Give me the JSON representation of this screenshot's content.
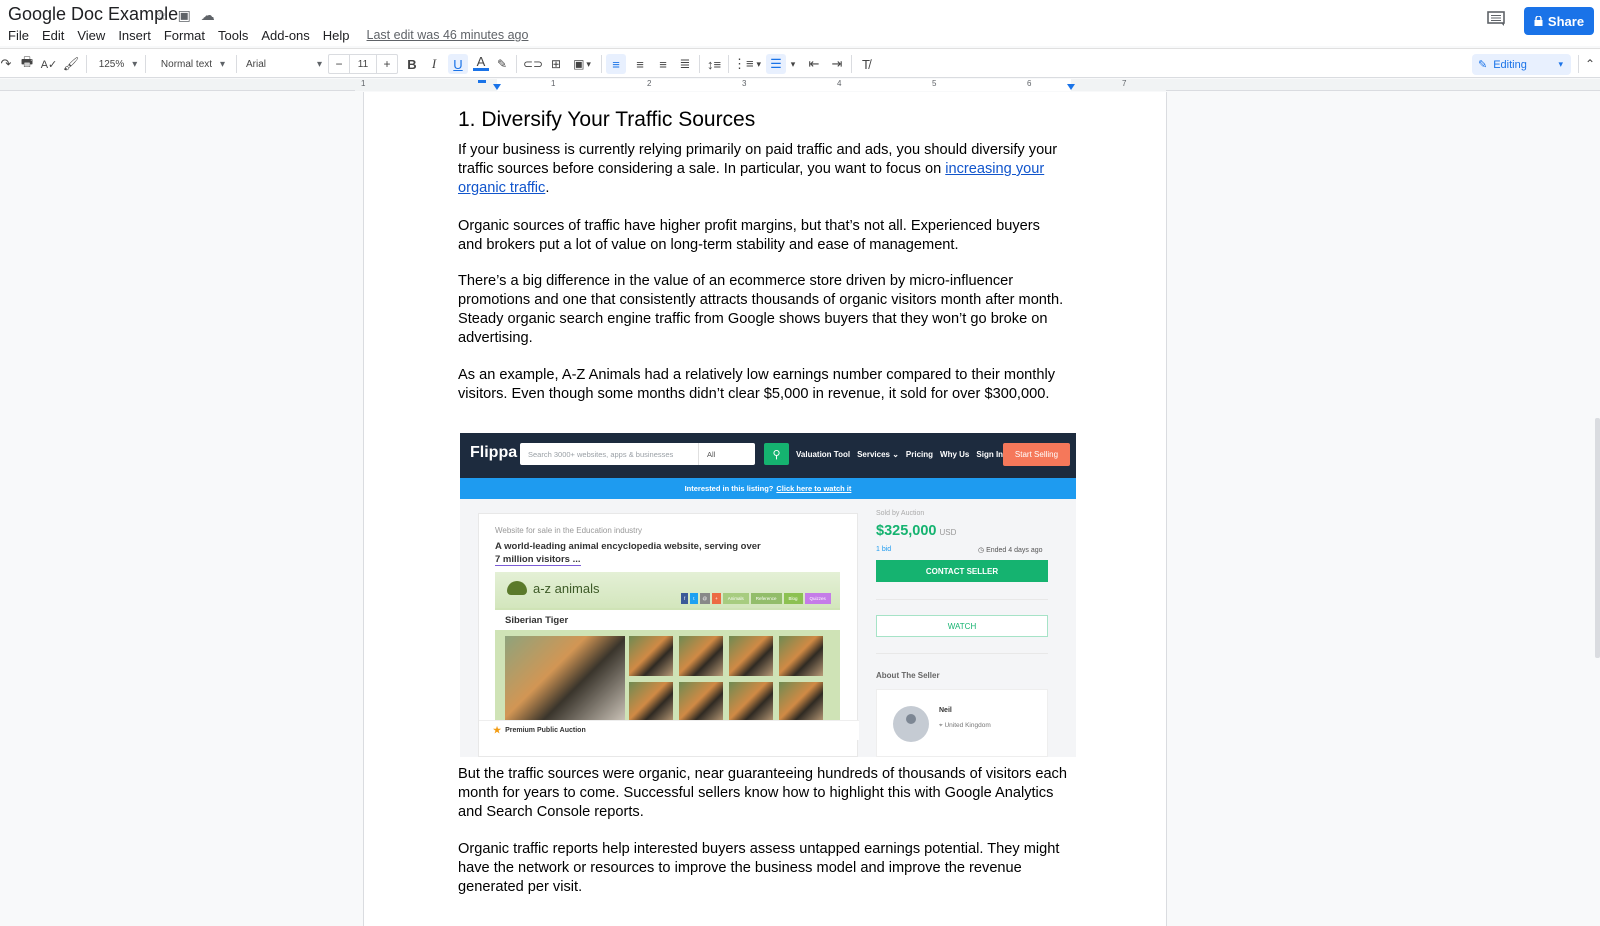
{
  "app": {
    "doc_title": "Google Doc Example",
    "last_edit": "Last edit was 46 minutes ago",
    "share_label": "Share",
    "mode_label": "Editing"
  },
  "menu": [
    "File",
    "Edit",
    "View",
    "Insert",
    "Format",
    "Tools",
    "Add-ons",
    "Help"
  ],
  "toolbar": {
    "zoom": "125%",
    "style": "Normal text",
    "font": "Arial",
    "font_size": "11",
    "minus": "−",
    "plus": "+"
  },
  "ruler": {
    "numbers": [
      "1",
      "1",
      "2",
      "3",
      "4",
      "5",
      "6",
      "7"
    ]
  },
  "document": {
    "heading": "1. Diversify Your Traffic Sources",
    "p1_before": "If your business is currently relying primarily on paid traffic and ads, you should diversify your traffic sources before considering a sale. In particular, you want to focus on ",
    "p1_link": "increasing your organic traffic",
    "p1_after": ".",
    "p2": "Organic sources of traffic have higher profit margins, but that’s not all. Experienced buyers and brokers put a lot of value on long-term stability and ease of management.",
    "p3": "There’s a big difference in the value of an ecommerce store driven by micro-influencer promotions and one that consistently attracts thousands of organic visitors month after month. Steady organic search engine traffic from Google shows buyers that they won’t go broke on advertising.",
    "p4": "As an example, A-Z Animals had a relatively low earnings number compared to their monthly visitors. Even though some months didn’t clear $5,000 in revenue, it sold for over $300,000.",
    "p5": "But the traffic sources were organic, near guaranteeing hundreds of thousands of visitors each month for years to come. Successful sellers know how to highlight this with Google Analytics and Search Console reports.",
    "p6": "Organic traffic reports help interested buyers assess untapped earnings potential. They might have the network or resources to improve the business model and improve the revenue generated per visit."
  },
  "embedded_image": {
    "logo": "Flippa",
    "search_placeholder": "Search 3000+ websites, apps & businesses",
    "search_scope": "All",
    "nav_links": [
      "Valuation Tool",
      "Services ⌄",
      "Pricing",
      "Why Us",
      "Sign In"
    ],
    "start_selling": "Start Selling",
    "banner_text": "Interested in this listing?",
    "banner_link": "Click here to watch it",
    "category": "Website for sale in the Education industry",
    "description_line1": "A world-leading animal encyclopedia website, serving over",
    "description_line2": "7 million visitors ...",
    "site_name": "a-z animals",
    "site_tabs": [
      "Animals",
      "Reference",
      "Blog",
      "Quizzes"
    ],
    "page_title": "Siberian Tiger",
    "premium": "Premium Public Auction",
    "sold_by": "Sold by Auction",
    "price": "$325,000",
    "currency": "USD",
    "bids": "1 bid",
    "ended": "Ended 4 days ago",
    "contact_seller": "CONTACT SELLER",
    "watch": "WATCH",
    "about_seller": "About The Seller",
    "seller_name": "Neil",
    "seller_location": "United Kingdom"
  }
}
